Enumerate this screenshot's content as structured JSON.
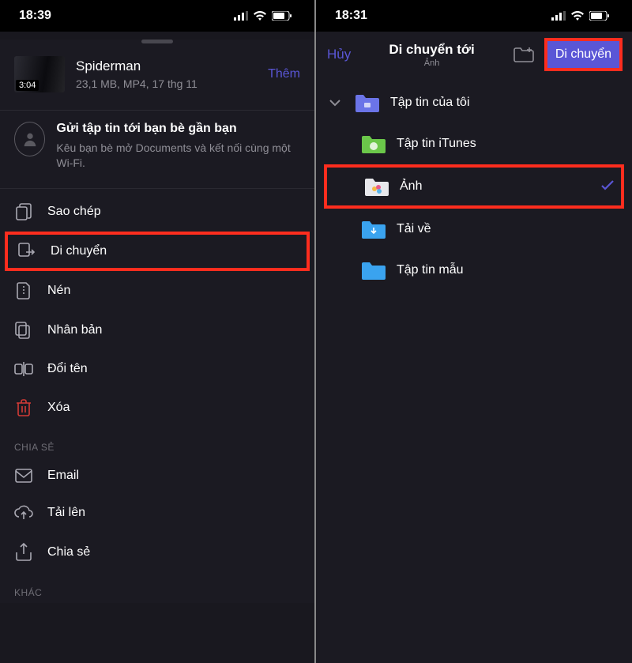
{
  "left": {
    "status_time": "18:39",
    "file": {
      "title": "Spiderman",
      "subtitle": "23,1 MB, MP4, 17 thg 11",
      "duration": "3:04",
      "action": "Thêm"
    },
    "share_prompt": {
      "title": "Gửi tập tin tới bạn bè gần bạn",
      "body": "Kêu bạn bè mở Documents và kết nối cùng một Wi-Fi."
    },
    "actions": {
      "copy": "Sao chép",
      "move": "Di chuyển",
      "compress": "Nén",
      "duplicate": "Nhân bản",
      "rename": "Đổi tên",
      "delete": "Xóa"
    },
    "section_share": "CHIA SẺ",
    "actions_share": {
      "email": "Email",
      "upload": "Tải lên",
      "share": "Chia sẻ"
    },
    "section_other": "KHÁC"
  },
  "right": {
    "status_time": "18:31",
    "nav": {
      "cancel": "Hủy",
      "title": "Di chuyển tới",
      "subtitle": "Ảnh",
      "move": "Di chuyển"
    },
    "tree": {
      "root": "Tập tin của tôi",
      "itunes": "Tập tin iTunes",
      "photos": "Ảnh",
      "downloads": "Tải về",
      "samples": "Tập tin mẫu"
    }
  }
}
